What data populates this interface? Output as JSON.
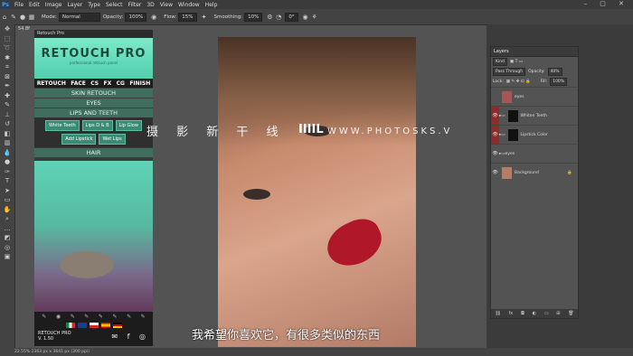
{
  "menu": {
    "logo": "Ps",
    "items": [
      "File",
      "Edit",
      "Image",
      "Layer",
      "Type",
      "Select",
      "Filter",
      "3D",
      "View",
      "Window",
      "Help"
    ]
  },
  "options": {
    "mode_label": "Mode:",
    "mode_value": "Normal",
    "opacity_label": "Opacity:",
    "opacity_value": "100%",
    "flow_label": "Flow:",
    "flow_value": "15%",
    "smoothing_label": "Smoothing:",
    "smoothing_value": "10%",
    "angle": "0°"
  },
  "doc_tab": "54.8f",
  "plugin": {
    "header": "Retouch Pro",
    "title": "RETOUCH PRO",
    "subtitle": "professional retouch panel",
    "tabs": [
      "RETOUCH",
      "FACE",
      "CS",
      "FX",
      "CG",
      "FINISH"
    ],
    "sections": [
      "SKIN RETOUCH",
      "EYES",
      "LIPS AND TEETH",
      "HAIR"
    ],
    "buttons": [
      "White Teeth",
      "Lips D & B",
      "Lip Glow",
      "Add Lipstick",
      "Wet Lips"
    ],
    "footer_name": "RETOUCH PRO",
    "footer_version": "V. 1.50"
  },
  "watermark": {
    "text": "摄 影 新 干 线",
    "logo": "IIIIL",
    "url": "WWW.PHOTOSKS.V"
  },
  "subtitle": "我希望你喜欢它，有很多类似的东西",
  "status": "22.55%   2363 px x 3641 px (300 ppi)",
  "layers": {
    "title": "Layers",
    "kind": "Kind",
    "blend": "Pass Through",
    "opacity_label": "Opacity:",
    "opacity": "40%",
    "lock_label": "Lock:",
    "fill_label": "Fill:",
    "fill": "100%",
    "items": [
      "eyes",
      "Whiten Teeth",
      "Lipstick Color",
      "eyes",
      "Background"
    ]
  },
  "colors": {
    "accent": "#4fd0ad",
    "lip_red": "#b0182a",
    "panel_bg": "#3a3a3a"
  }
}
